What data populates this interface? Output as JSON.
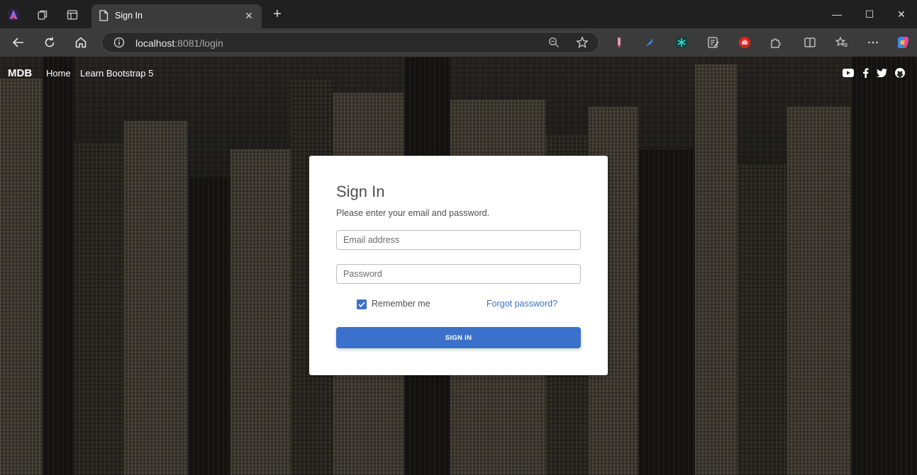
{
  "browser": {
    "tab_title": "Sign In",
    "tab_close": "✕",
    "new_tab": "+",
    "address_host": "localhost",
    "address_rest": ":8081/login",
    "window_controls": {
      "minimize": "—",
      "maximize": "☐",
      "close": "✕"
    }
  },
  "navbar": {
    "brand": "MDB",
    "links": [
      "Home",
      "Learn Bootstrap 5"
    ],
    "social_icons": [
      "youtube-icon",
      "facebook-icon",
      "twitter-icon",
      "github-icon"
    ]
  },
  "login_card": {
    "title": "Sign In",
    "subtitle": "Please enter your email and password.",
    "email_placeholder": "Email address",
    "password_placeholder": "Password",
    "remember_label": "Remember me",
    "remember_checked": true,
    "forgot_label": "Forgot password?",
    "submit_label": "SIGN IN"
  },
  "colors": {
    "primary": "#3b71ca",
    "card_bg": "#ffffff",
    "tab_bar": "#202020",
    "toolbar": "#3b3b3b"
  }
}
